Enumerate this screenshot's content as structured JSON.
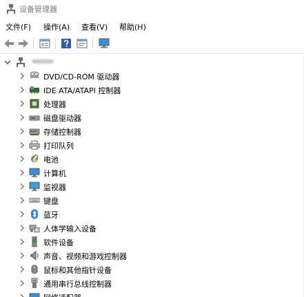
{
  "window": {
    "title": "设备管理器"
  },
  "menu": [
    {
      "label": "文件(F)"
    },
    {
      "label": "操作(A)"
    },
    {
      "label": "查看(V)"
    },
    {
      "label": "帮助(H)"
    }
  ],
  "tree": {
    "root": {
      "label": ""
    },
    "categories": [
      {
        "label": "DVD/CD-ROM 驱动器",
        "icon": "dvd-drive-icon"
      },
      {
        "label": "IDE ATA/ATAPI 控制器",
        "icon": "ide-controller-icon"
      },
      {
        "label": "处理器",
        "icon": "processor-icon"
      },
      {
        "label": "磁盘驱动器",
        "icon": "disk-drive-icon"
      },
      {
        "label": "存储控制器",
        "icon": "storage-controller-icon"
      },
      {
        "label": "打印队列",
        "icon": "printer-icon"
      },
      {
        "label": "电池",
        "icon": "battery-icon"
      },
      {
        "label": "计算机",
        "icon": "computer-icon"
      },
      {
        "label": "监视器",
        "icon": "monitor-icon"
      },
      {
        "label": "键盘",
        "icon": "keyboard-icon"
      },
      {
        "label": "蓝牙",
        "icon": "bluetooth-icon"
      },
      {
        "label": "人体学输入设备",
        "icon": "hid-icon"
      },
      {
        "label": "软件设备",
        "icon": "software-device-icon"
      },
      {
        "label": "声音、视频和游戏控制器",
        "icon": "sound-icon"
      },
      {
        "label": "鼠标和其他指针设备",
        "icon": "mouse-icon"
      },
      {
        "label": "通用串行总线控制器",
        "icon": "usb-icon"
      },
      {
        "label": "网络适配器",
        "icon": "network-adapter-icon"
      }
    ]
  }
}
